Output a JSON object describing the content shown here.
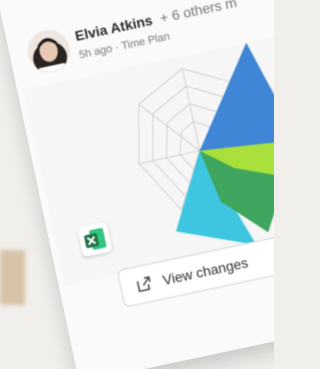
{
  "card": {
    "author": "Elvia Atkins",
    "others": "+ 6 others m",
    "meta": "5h ago · Time Plan",
    "button_label": "View changes"
  },
  "icons": {
    "avatar": "avatar",
    "excel": "excel-icon",
    "open": "open-external-icon"
  },
  "colors": {
    "chart_blue": "#3f86d6",
    "chart_cyan": "#3ec6e0",
    "chart_lime": "#a9e03c",
    "chart_green": "#3fa55f",
    "excel_green": "#1e7145"
  }
}
